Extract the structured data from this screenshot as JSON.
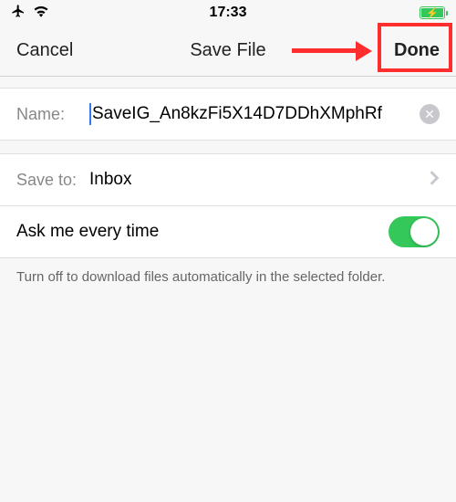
{
  "status": {
    "time": "17:33"
  },
  "nav": {
    "cancel": "Cancel",
    "title": "Save File",
    "done": "Done"
  },
  "name_row": {
    "label": "Name:",
    "value": "SaveIG_An8kzFi5X14D7DDhXMphRf"
  },
  "saveto_row": {
    "label": "Save to:",
    "value": "Inbox"
  },
  "toggle_row": {
    "label": "Ask me every time",
    "on": true
  },
  "footer": {
    "text": "Turn off to download files automatically in the selected folder."
  }
}
